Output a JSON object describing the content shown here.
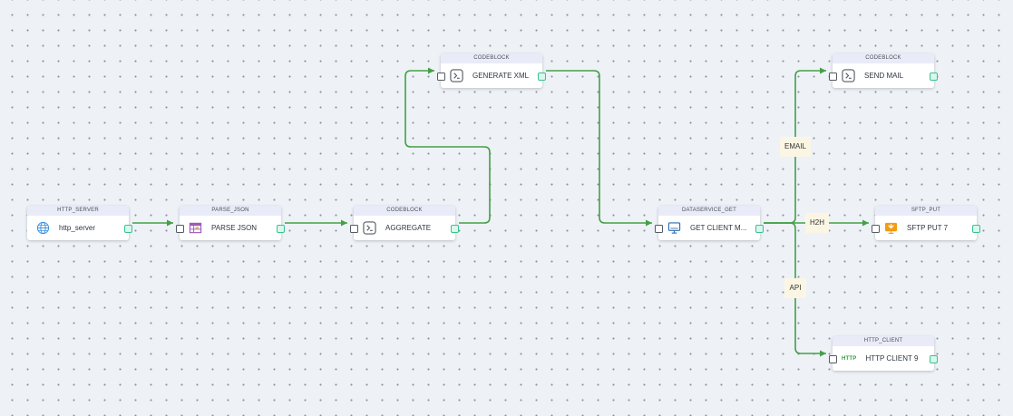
{
  "colors": {
    "edge": "#43a047",
    "port_out": "#38c28e",
    "header_bg": "#e9ebf8",
    "edge_label_bg": "#fbf6e4"
  },
  "nodes": {
    "http_server": {
      "type": "HTTP_SERVER",
      "label": "http_server",
      "icon": "globe-icon"
    },
    "parse_json": {
      "type": "PARSE_JSON",
      "label": "PARSE JSON",
      "icon": "table-icon"
    },
    "aggregate": {
      "type": "CODEBLOCK",
      "label": "AGGREGATE",
      "icon": "terminal-icon"
    },
    "generate_xml": {
      "type": "CODEBLOCK",
      "label": "GENERATE XML",
      "icon": "terminal-icon"
    },
    "get_client": {
      "type": "DATASERVICE_GET",
      "label": "GET CLIENT M...",
      "icon": "monitor-icon"
    },
    "send_mail": {
      "type": "CODEBLOCK",
      "label": "SEND MAIL",
      "icon": "terminal-icon"
    },
    "sftp_put": {
      "type": "SFTP_PUT",
      "label": "SFTP PUT 7",
      "icon": "sftp-icon"
    },
    "http_client": {
      "type": "HTTP_CLIENT",
      "label": "HTTP CLIENT 9",
      "icon": "http-icon",
      "icon_text": "HTTP"
    }
  },
  "edge_labels": {
    "email": "EMAIL",
    "h2h": "H2H",
    "api": "API"
  }
}
